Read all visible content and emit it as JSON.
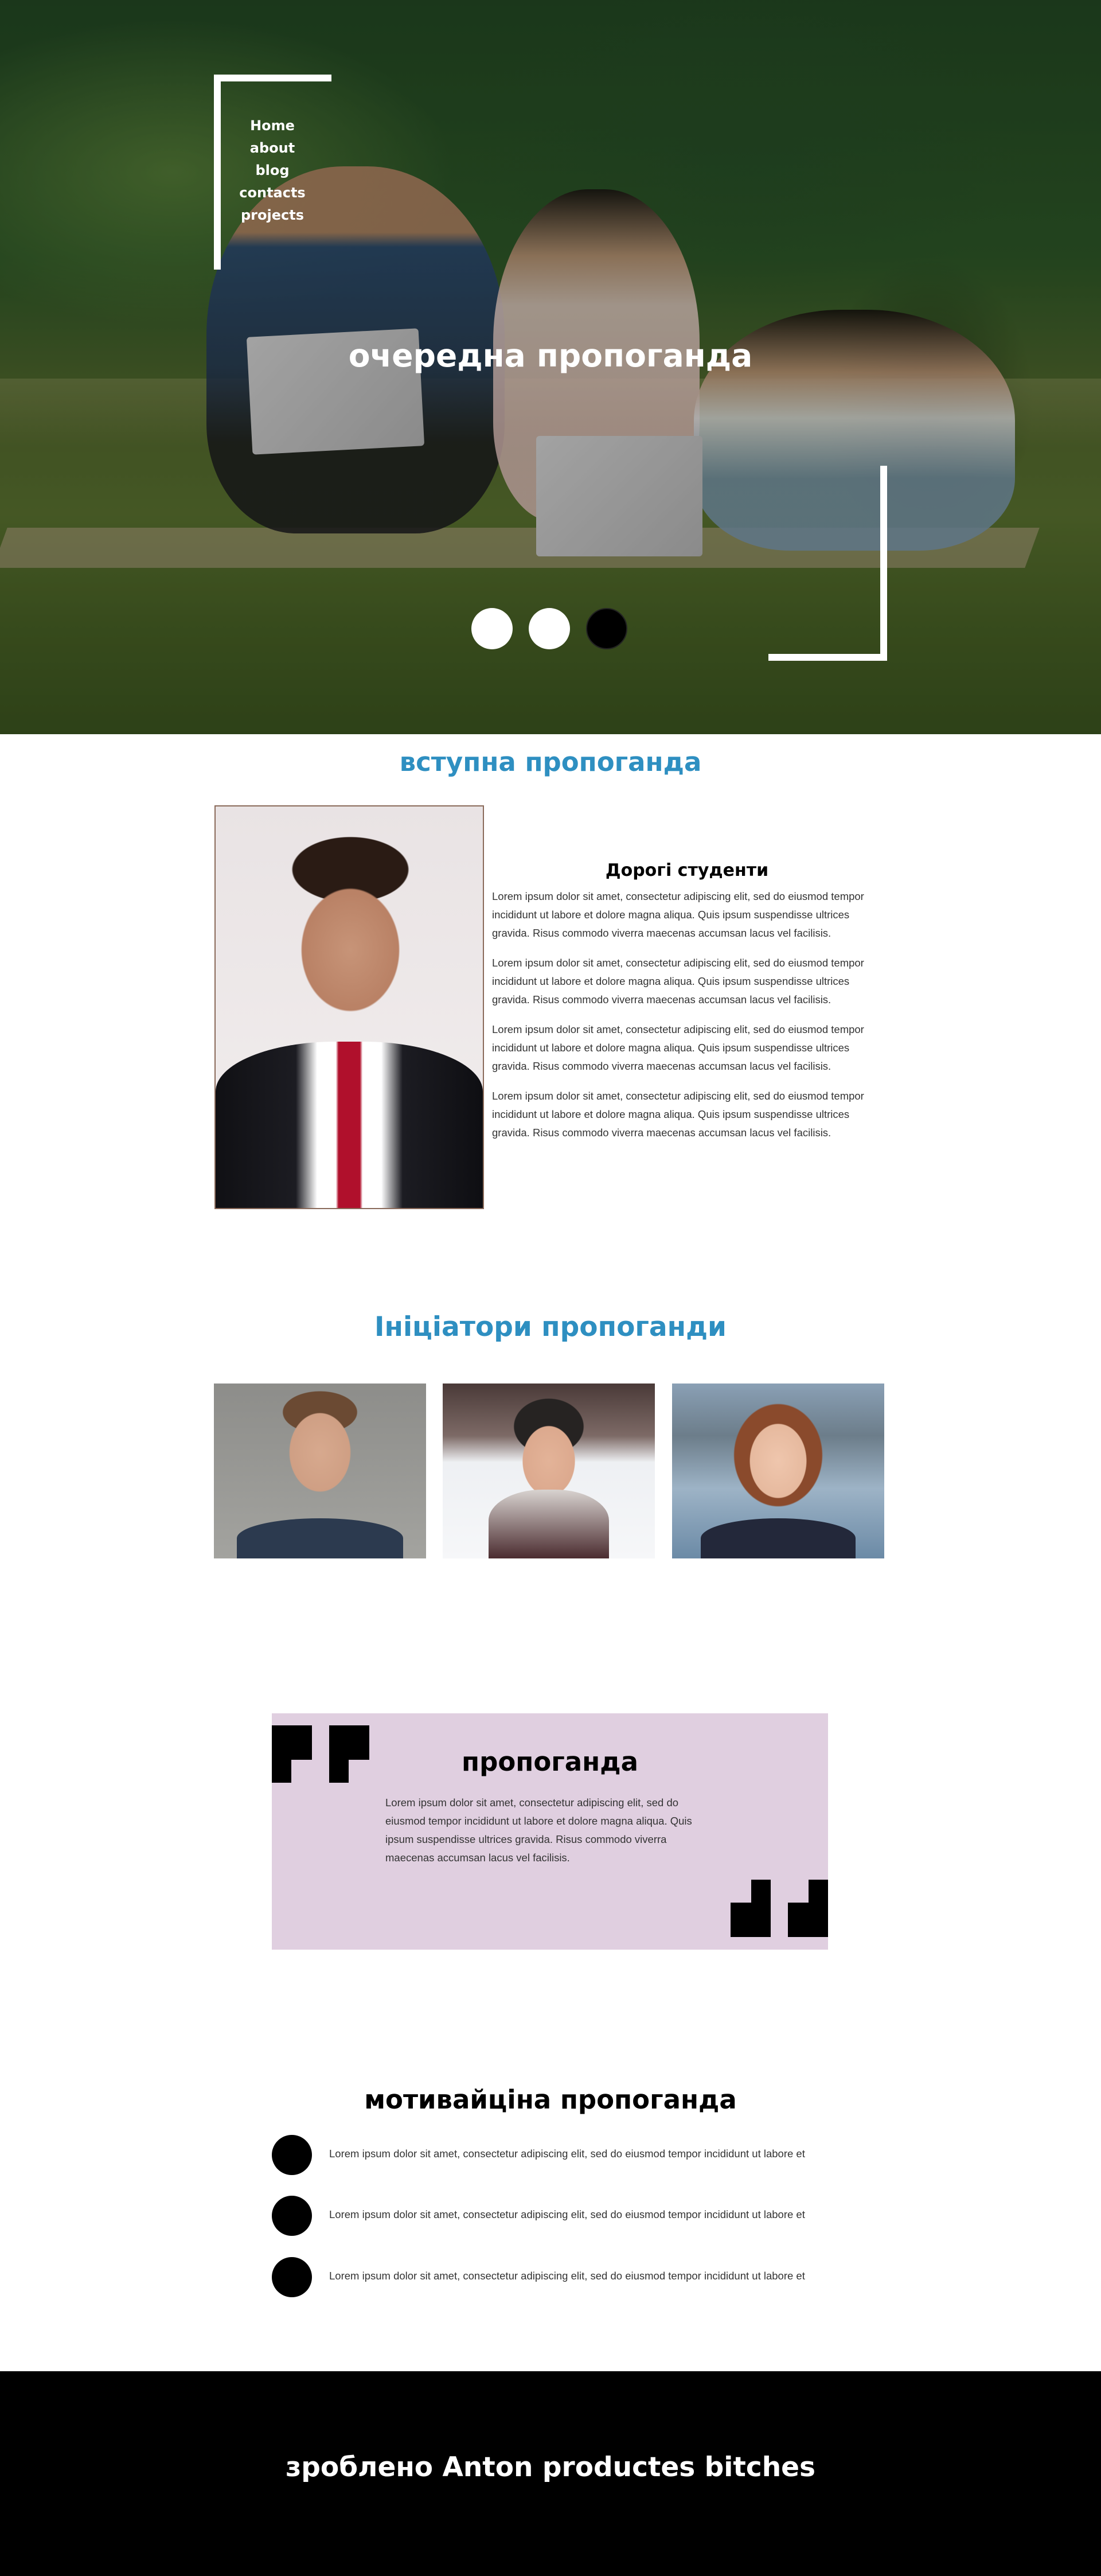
{
  "nav": {
    "items": [
      "Home",
      "about",
      "blog",
      "contacts",
      "projects"
    ]
  },
  "hero": {
    "title": "очередна пропоганда",
    "slider_dots": [
      {
        "state": "inactive",
        "color": "#ffffff"
      },
      {
        "state": "inactive",
        "color": "#ffffff"
      },
      {
        "state": "active",
        "color": "#000000"
      }
    ]
  },
  "intro": {
    "title": "вступна пропоганда",
    "heading": "Дорогі студенти",
    "paragraphs": [
      "Lorem ipsum dolor sit amet, consectetur adipiscing elit, sed do eiusmod tempor incididunt ut labore et dolore magna aliqua. Quis ipsum suspendisse ultrices gravida. Risus commodo viverra maecenas accumsan lacus vel facilisis.",
      "Lorem ipsum dolor sit amet, consectetur adipiscing elit, sed do eiusmod tempor incididunt ut labore et dolore magna aliqua. Quis ipsum suspendisse ultrices gravida. Risus commodo viverra maecenas accumsan lacus vel facilisis.",
      "Lorem ipsum dolor sit amet, consectetur adipiscing elit, sed do eiusmod tempor incididunt ut labore et dolore magna aliqua. Quis ipsum suspendisse ultrices gravida. Risus commodo viverra maecenas accumsan lacus vel facilisis.",
      "Lorem ipsum dolor sit amet, consectetur adipiscing elit, sed do eiusmod tempor incididunt ut labore et dolore magna aliqua. Quis ipsum suspendisse ultrices gravida. Risus commodo viverra maecenas accumsan lacus vel facilisis."
    ]
  },
  "initiators": {
    "title": "Ініціатори пропоганди"
  },
  "quote": {
    "title": "пропоганда",
    "text": "Lorem ipsum dolor sit amet, consectetur adipiscing elit, sed do eiusmod tempor incididunt ut labore et dolore magna aliqua. Quis ipsum suspendisse ultrices gravida. Risus commodo viverra maecenas accumsan lacus vel facilisis."
  },
  "motivation": {
    "title": "мотивайціна пропоганда",
    "items": [
      "Lorem ipsum dolor sit amet, consectetur adipiscing elit, sed do eiusmod tempor incididunt ut labore et",
      "Lorem ipsum dolor sit amet, consectetur adipiscing elit, sed do eiusmod tempor incididunt ut labore et",
      "Lorem ipsum dolor sit amet, consectetur adipiscing elit, sed do eiusmod tempor incididunt ut labore et"
    ]
  },
  "footer": {
    "text": "зроблено Anton productes bitches"
  },
  "colors": {
    "accent_blue": "#2e8fc1",
    "quote_background": "#e0cfe0",
    "footer_background": "#000000"
  }
}
